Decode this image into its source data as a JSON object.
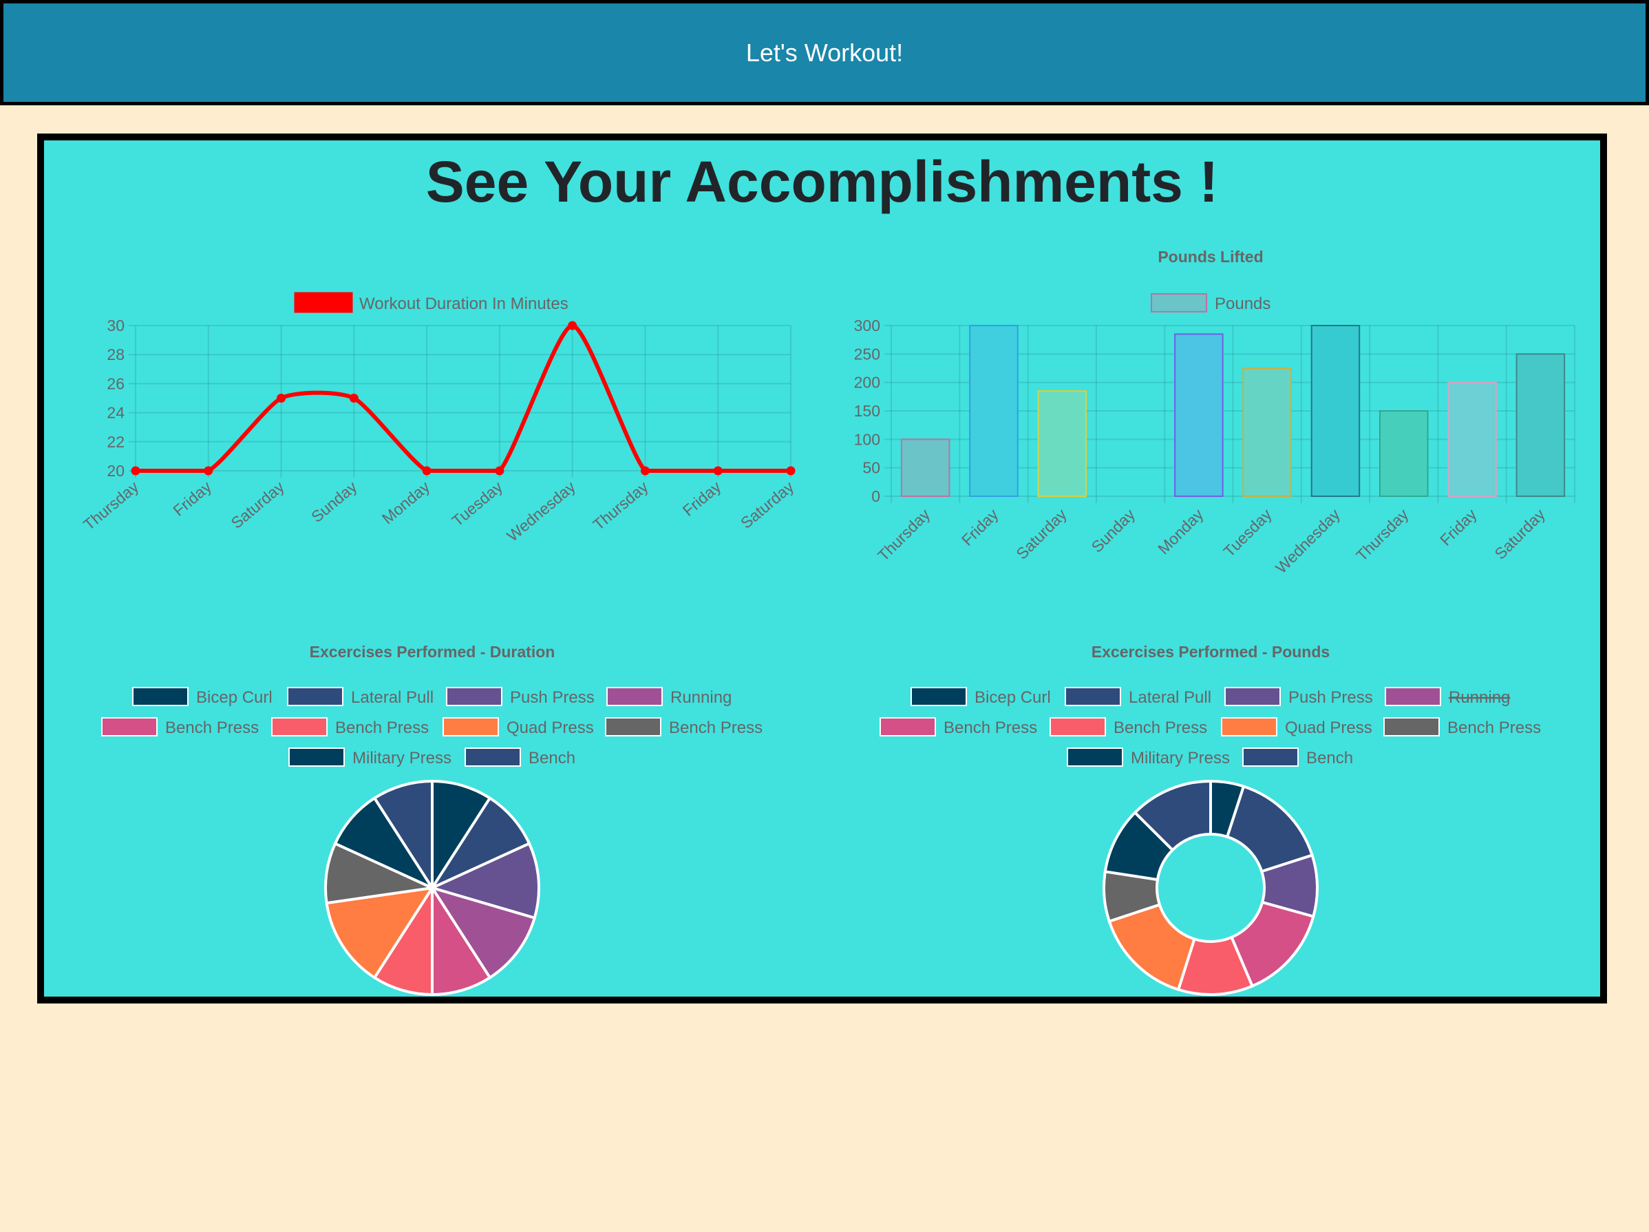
{
  "navbar": {
    "title": "Let's Workout!"
  },
  "main": {
    "title": "See Your Accomplishments !"
  },
  "colors": {
    "navbar": "#1a86a9",
    "panel": "#41e1de",
    "page": "#ffedcf",
    "line": "#ff0000",
    "text": "#666666"
  },
  "chart_data": [
    {
      "type": "line",
      "title": "",
      "legend": "Workout Duration In Minutes",
      "legend_color": "#ff0000",
      "categories": [
        "Thursday",
        "Friday",
        "Saturday",
        "Sunday",
        "Monday",
        "Tuesday",
        "Wednesday",
        "Thursday",
        "Friday",
        "Saturday"
      ],
      "values": [
        20,
        20,
        25,
        25,
        20,
        20,
        30,
        20,
        20,
        20
      ],
      "ylim": [
        20,
        30
      ],
      "yticks": [
        20,
        22,
        24,
        26,
        28,
        30
      ],
      "grid": true,
      "legend_position": "top"
    },
    {
      "type": "bar",
      "title": "Pounds Lifted",
      "legend": "Pounds",
      "categories": [
        "Thursday",
        "Friday",
        "Saturday",
        "Sunday",
        "Monday",
        "Tuesday",
        "Wednesday",
        "Thursday",
        "Friday",
        "Saturday"
      ],
      "values": [
        100,
        300,
        185,
        0,
        285,
        225,
        300,
        150,
        200,
        250
      ],
      "bar_colors": [
        "#6bc4c8",
        "#3fcfdf",
        "#6cdcc0",
        "#41e1de",
        "#4cc4e4",
        "#66d4c4",
        "#36cbd0",
        "#46d0bc",
        "#6cd0d4",
        "#46c8c8"
      ],
      "bar_borders": [
        "#c070a0",
        "#30a0e0",
        "#d8d040",
        "#41e1de",
        "#7060e0",
        "#c8b040",
        "#207888",
        "#30a890",
        "#e0a0c0",
        "#408888"
      ],
      "ylim": [
        0,
        300
      ],
      "yticks": [
        0,
        50,
        100,
        150,
        200,
        250,
        300
      ],
      "grid": true,
      "legend_position": "top"
    },
    {
      "type": "pie",
      "title": "Excercises Performed - Duration",
      "labels": [
        "Bicep Curl",
        "Lateral Pull",
        "Push Press",
        "Running",
        "Bench Press",
        "Bench Press",
        "Quad Press",
        "Bench Press",
        "Military Press",
        "Bench"
      ],
      "values": [
        20,
        20,
        25,
        25,
        20,
        20,
        30,
        20,
        20,
        20
      ],
      "colors": [
        "#003f5c",
        "#2f4b7c",
        "#665191",
        "#a05195",
        "#d45087",
        "#f95d6a",
        "#ff7c43",
        "#666666",
        "#003f5c",
        "#2f4b7c"
      ],
      "legend_position": "top"
    },
    {
      "type": "doughnut",
      "title": "Excercises Performed - Pounds",
      "labels": [
        "Bicep Curl",
        "Lateral Pull",
        "Push Press",
        "Running",
        "Bench Press",
        "Bench Press",
        "Quad Press",
        "Bench Press",
        "Military Press",
        "Bench"
      ],
      "values": [
        100,
        300,
        185,
        0,
        285,
        225,
        300,
        150,
        200,
        250
      ],
      "hidden": [
        false,
        false,
        false,
        true,
        false,
        false,
        false,
        false,
        false,
        false
      ],
      "colors": [
        "#003f5c",
        "#2f4b7c",
        "#665191",
        "#a05195",
        "#d45087",
        "#f95d6a",
        "#ff7c43",
        "#666666",
        "#003f5c",
        "#2f4b7c"
      ],
      "legend_position": "top"
    }
  ]
}
